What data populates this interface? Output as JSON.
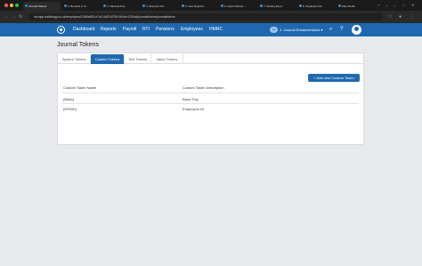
{
  "browser": {
    "tabs": [
      {
        "label": "Journal Tokens",
        "active": true
      },
      {
        "label": "2. Benefits in Ki..."
      },
      {
        "label": "3. National Pay..."
      },
      {
        "label": "4. Absence Per..."
      },
      {
        "label": "5. New Reports..."
      },
      {
        "label": "6. Import Enhan..."
      },
      {
        "label": "7. Sorting Empl..."
      },
      {
        "label": "8. Duplicate Rol..."
      },
      {
        "label": "Flite Studio"
      }
    ],
    "url": "set-app.staffology.co.uk/employers/22b5e683-e7a3-4d29-8796-f5d4ec1153cd/journaltokens/journaltokens",
    "colors": {
      "tabstrip": "#1b1b1b",
      "active_tab": "#2a2a2a",
      "traffic_red": "#ff5f57",
      "traffic_yellow": "#febc2e",
      "traffic_green": "#28c840"
    }
  },
  "nav": {
    "items": [
      "Dashboard",
      "Reports",
      "Payroll",
      "RTI",
      "Pensions",
      "Employees",
      "HMRC"
    ],
    "company": "1. Journal Enhancements",
    "company_badge": "JE",
    "accent": "#1f68b0"
  },
  "page": {
    "title": "Journal Tokens",
    "tabs": [
      "System Tokens",
      "Custom Tokens",
      "Text Tokens",
      "Value Tokens"
    ],
    "active_tab": "Custom Tokens",
    "add_button": "Add new Custom Token",
    "columns": [
      "Custom Token Name",
      "Custom Token Description"
    ],
    "rows": [
      {
        "name": "{Basic}",
        "description": "Basic Pay"
      },
      {
        "name": "{ERSNI}",
        "description": "Employers NI"
      }
    ]
  },
  "icons": {
    "back": "arrow-left-icon",
    "forward": "arrow-right-icon",
    "reload": "reload-icon",
    "search": "search-icon",
    "help": "help-icon",
    "avatar": "user-avatar-icon",
    "add": "plus-icon"
  }
}
